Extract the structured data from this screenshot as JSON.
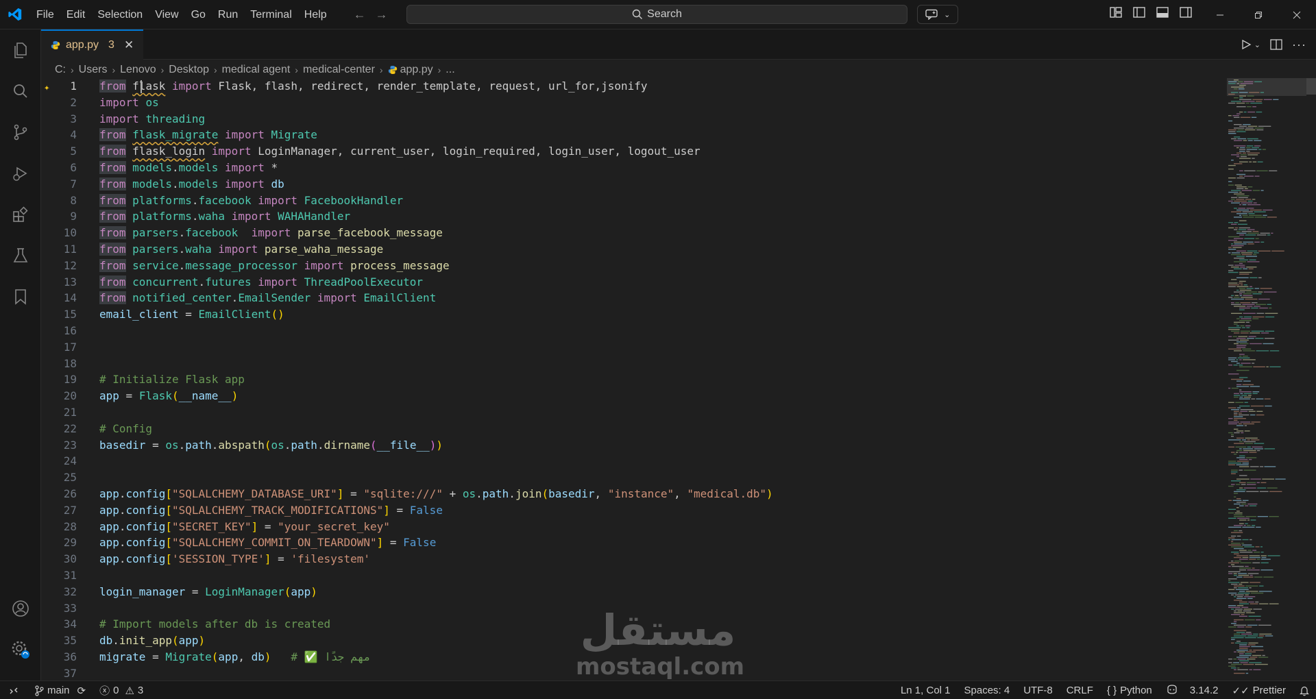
{
  "menu": [
    "File",
    "Edit",
    "Selection",
    "View",
    "Go",
    "Run",
    "Terminal",
    "Help"
  ],
  "search": {
    "label": "Search"
  },
  "tab": {
    "filename": "app.py",
    "problems": "3"
  },
  "breadcrumb": [
    "C:",
    "Users",
    "Lenovo",
    "Desktop",
    "medical agent",
    "medical-center",
    "app.py",
    "..."
  ],
  "editor": {
    "lines": [
      {
        "n": "1",
        "tokens": [
          [
            "kf",
            "from"
          ],
          [
            "w",
            " "
          ],
          [
            "w sq",
            "flask"
          ],
          [
            "w",
            " "
          ],
          [
            "k",
            "import"
          ],
          [
            "w",
            " Flask, flash, redirect, render_template, request, url_for,jsonify"
          ]
        ]
      },
      {
        "n": "2",
        "tokens": [
          [
            "k",
            "import"
          ],
          [
            "w",
            " "
          ],
          [
            "m",
            "os"
          ]
        ]
      },
      {
        "n": "3",
        "tokens": [
          [
            "k",
            "import"
          ],
          [
            "w",
            " "
          ],
          [
            "m",
            "threading"
          ]
        ]
      },
      {
        "n": "4",
        "tokens": [
          [
            "kf",
            "from"
          ],
          [
            "w",
            " "
          ],
          [
            "m sq",
            "flask_migrate"
          ],
          [
            "w",
            " "
          ],
          [
            "k",
            "import"
          ],
          [
            "w",
            " "
          ],
          [
            "m",
            "Migrate"
          ]
        ]
      },
      {
        "n": "5",
        "tokens": [
          [
            "kf",
            "from"
          ],
          [
            "w",
            " "
          ],
          [
            "w sq",
            "flask_login"
          ],
          [
            "w",
            " "
          ],
          [
            "k",
            "import"
          ],
          [
            "w",
            " LoginManager, current_user, login_required, login_user, logout_user"
          ]
        ]
      },
      {
        "n": "6",
        "tokens": [
          [
            "kf",
            "from"
          ],
          [
            "w",
            " "
          ],
          [
            "m",
            "models"
          ],
          [
            "w",
            "."
          ],
          [
            "m",
            "models"
          ],
          [
            "w",
            " "
          ],
          [
            "k",
            "import"
          ],
          [
            "w",
            " *"
          ]
        ]
      },
      {
        "n": "7",
        "tokens": [
          [
            "kf",
            "from"
          ],
          [
            "w",
            " "
          ],
          [
            "m",
            "models"
          ],
          [
            "w",
            "."
          ],
          [
            "m",
            "models"
          ],
          [
            "w",
            " "
          ],
          [
            "k",
            "import"
          ],
          [
            "w",
            " "
          ],
          [
            "v",
            "db"
          ]
        ]
      },
      {
        "n": "8",
        "tokens": [
          [
            "kf",
            "from"
          ],
          [
            "w",
            " "
          ],
          [
            "m",
            "platforms"
          ],
          [
            "w",
            "."
          ],
          [
            "m",
            "facebook"
          ],
          [
            "w",
            " "
          ],
          [
            "k",
            "import"
          ],
          [
            "w",
            " "
          ],
          [
            "m",
            "FacebookHandler"
          ]
        ]
      },
      {
        "n": "9",
        "tokens": [
          [
            "kf",
            "from"
          ],
          [
            "w",
            " "
          ],
          [
            "m",
            "platforms"
          ],
          [
            "w",
            "."
          ],
          [
            "m",
            "waha"
          ],
          [
            "w",
            " "
          ],
          [
            "k",
            "import"
          ],
          [
            "w",
            " "
          ],
          [
            "m",
            "WAHAHandler"
          ]
        ]
      },
      {
        "n": "10",
        "tokens": [
          [
            "kf",
            "from"
          ],
          [
            "w",
            " "
          ],
          [
            "m",
            "parsers"
          ],
          [
            "w",
            "."
          ],
          [
            "m",
            "facebook"
          ],
          [
            "w",
            "  "
          ],
          [
            "k",
            "import"
          ],
          [
            "w",
            " "
          ],
          [
            "f",
            "parse_facebook_message"
          ]
        ]
      },
      {
        "n": "11",
        "tokens": [
          [
            "kf",
            "from"
          ],
          [
            "w",
            " "
          ],
          [
            "m",
            "parsers"
          ],
          [
            "w",
            "."
          ],
          [
            "m",
            "waha"
          ],
          [
            "w",
            " "
          ],
          [
            "k",
            "import"
          ],
          [
            "w",
            " "
          ],
          [
            "f",
            "parse_waha_message"
          ]
        ]
      },
      {
        "n": "12",
        "tokens": [
          [
            "kf",
            "from"
          ],
          [
            "w",
            " "
          ],
          [
            "m",
            "service"
          ],
          [
            "w",
            "."
          ],
          [
            "m",
            "message_processor"
          ],
          [
            "w",
            " "
          ],
          [
            "k",
            "import"
          ],
          [
            "w",
            " "
          ],
          [
            "f",
            "process_message"
          ]
        ]
      },
      {
        "n": "13",
        "tokens": [
          [
            "kf",
            "from"
          ],
          [
            "w",
            " "
          ],
          [
            "m",
            "concurrent"
          ],
          [
            "w",
            "."
          ],
          [
            "m",
            "futures"
          ],
          [
            "w",
            " "
          ],
          [
            "k",
            "import"
          ],
          [
            "w",
            " "
          ],
          [
            "m",
            "ThreadPoolExecutor"
          ]
        ]
      },
      {
        "n": "14",
        "tokens": [
          [
            "kf",
            "from"
          ],
          [
            "w",
            " "
          ],
          [
            "m",
            "notified_center"
          ],
          [
            "w",
            "."
          ],
          [
            "m",
            "EmailSender"
          ],
          [
            "w",
            " "
          ],
          [
            "k",
            "import"
          ],
          [
            "w",
            " "
          ],
          [
            "m",
            "EmailClient"
          ]
        ]
      },
      {
        "n": "15",
        "tokens": [
          [
            "v",
            "email_client"
          ],
          [
            "w",
            " = "
          ],
          [
            "m",
            "EmailClient"
          ],
          [
            "p",
            "()"
          ]
        ]
      },
      {
        "n": "16",
        "tokens": []
      },
      {
        "n": "17",
        "tokens": []
      },
      {
        "n": "18",
        "tokens": []
      },
      {
        "n": "19",
        "tokens": [
          [
            "c",
            "# Initialize Flask app"
          ]
        ]
      },
      {
        "n": "20",
        "tokens": [
          [
            "v",
            "app"
          ],
          [
            "w",
            " = "
          ],
          [
            "m",
            "Flask"
          ],
          [
            "p",
            "("
          ],
          [
            "v",
            "__name__"
          ],
          [
            "p",
            ")"
          ]
        ]
      },
      {
        "n": "21",
        "tokens": []
      },
      {
        "n": "22",
        "tokens": [
          [
            "c",
            "# Config"
          ]
        ]
      },
      {
        "n": "23",
        "tokens": [
          [
            "v",
            "basedir"
          ],
          [
            "w",
            " = "
          ],
          [
            "m",
            "os"
          ],
          [
            "w",
            "."
          ],
          [
            "v",
            "path"
          ],
          [
            "w",
            "."
          ],
          [
            "f",
            "abspath"
          ],
          [
            "p",
            "("
          ],
          [
            "m",
            "os"
          ],
          [
            "w",
            "."
          ],
          [
            "v",
            "path"
          ],
          [
            "w",
            "."
          ],
          [
            "f",
            "dirname"
          ],
          [
            "p2",
            "("
          ],
          [
            "v",
            "__file__"
          ],
          [
            "p2",
            ")"
          ],
          [
            "p",
            ")"
          ]
        ]
      },
      {
        "n": "24",
        "tokens": []
      },
      {
        "n": "25",
        "tokens": []
      },
      {
        "n": "26",
        "tokens": [
          [
            "v",
            "app"
          ],
          [
            "w",
            "."
          ],
          [
            "v",
            "config"
          ],
          [
            "p",
            "["
          ],
          [
            "s",
            "\"SQLALCHEMY_DATABASE_URI\""
          ],
          [
            "p",
            "]"
          ],
          [
            "w",
            " = "
          ],
          [
            "s",
            "\"sqlite:///\""
          ],
          [
            "w",
            " + "
          ],
          [
            "m",
            "os"
          ],
          [
            "w",
            "."
          ],
          [
            "v",
            "path"
          ],
          [
            "w",
            "."
          ],
          [
            "f",
            "join"
          ],
          [
            "p",
            "("
          ],
          [
            "v",
            "basedir"
          ],
          [
            "w",
            ", "
          ],
          [
            "s",
            "\"instance\""
          ],
          [
            "w",
            ", "
          ],
          [
            "s",
            "\"medical.db\""
          ],
          [
            "p",
            ")"
          ]
        ]
      },
      {
        "n": "27",
        "tokens": [
          [
            "v",
            "app"
          ],
          [
            "w",
            "."
          ],
          [
            "v",
            "config"
          ],
          [
            "p",
            "["
          ],
          [
            "s",
            "\"SQLALCHEMY_TRACK_MODIFICATIONS\""
          ],
          [
            "p",
            "]"
          ],
          [
            "w",
            " = "
          ],
          [
            "b",
            "False"
          ]
        ]
      },
      {
        "n": "28",
        "tokens": [
          [
            "v",
            "app"
          ],
          [
            "w",
            "."
          ],
          [
            "v",
            "config"
          ],
          [
            "p",
            "["
          ],
          [
            "s",
            "\"SECRET_KEY\""
          ],
          [
            "p",
            "]"
          ],
          [
            "w",
            " = "
          ],
          [
            "s",
            "\"your_secret_key\""
          ]
        ]
      },
      {
        "n": "29",
        "tokens": [
          [
            "v",
            "app"
          ],
          [
            "w",
            "."
          ],
          [
            "v",
            "config"
          ],
          [
            "p",
            "["
          ],
          [
            "s",
            "\"SQLALCHEMY_COMMIT_ON_TEARDOWN\""
          ],
          [
            "p",
            "]"
          ],
          [
            "w",
            " = "
          ],
          [
            "b",
            "False"
          ]
        ]
      },
      {
        "n": "30",
        "tokens": [
          [
            "v",
            "app"
          ],
          [
            "w",
            "."
          ],
          [
            "v",
            "config"
          ],
          [
            "p",
            "["
          ],
          [
            "s",
            "'SESSION_TYPE'"
          ],
          [
            "p",
            "]"
          ],
          [
            "w",
            " = "
          ],
          [
            "s",
            "'filesystem'"
          ]
        ]
      },
      {
        "n": "31",
        "tokens": []
      },
      {
        "n": "32",
        "tokens": [
          [
            "v",
            "login_manager"
          ],
          [
            "w",
            " = "
          ],
          [
            "m",
            "LoginManager"
          ],
          [
            "p",
            "("
          ],
          [
            "v",
            "app"
          ],
          [
            "p",
            ")"
          ]
        ]
      },
      {
        "n": "33",
        "tokens": []
      },
      {
        "n": "34",
        "tokens": [
          [
            "c",
            "# Import models after db is created"
          ]
        ]
      },
      {
        "n": "35",
        "tokens": [
          [
            "v",
            "db"
          ],
          [
            "w",
            "."
          ],
          [
            "f",
            "init_app"
          ],
          [
            "p",
            "("
          ],
          [
            "v",
            "app"
          ],
          [
            "p",
            ")"
          ]
        ]
      },
      {
        "n": "36",
        "tokens": [
          [
            "v",
            "migrate"
          ],
          [
            "w",
            " = "
          ],
          [
            "m",
            "Migrate"
          ],
          [
            "p",
            "("
          ],
          [
            "v",
            "app"
          ],
          [
            "w",
            ", "
          ],
          [
            "v",
            "db"
          ],
          [
            "p",
            ")"
          ],
          [
            "w",
            "   "
          ],
          [
            "c",
            "# ✅ مهم جدًا"
          ]
        ]
      },
      {
        "n": "37",
        "tokens": []
      }
    ]
  },
  "status": {
    "branch": "main",
    "errors": "0",
    "warnings": "3",
    "position": "Ln 1, Col 1",
    "spaces": "Spaces: 4",
    "encoding": "UTF-8",
    "eol": "CRLF",
    "language": "Python",
    "python_version": "3.14.2",
    "formatter": "Prettier"
  },
  "watermark": {
    "arabic": "مستقل",
    "latin": "mostaql.com"
  },
  "colors": {
    "accent": "#0078d4",
    "modified": "#e2c08d"
  }
}
